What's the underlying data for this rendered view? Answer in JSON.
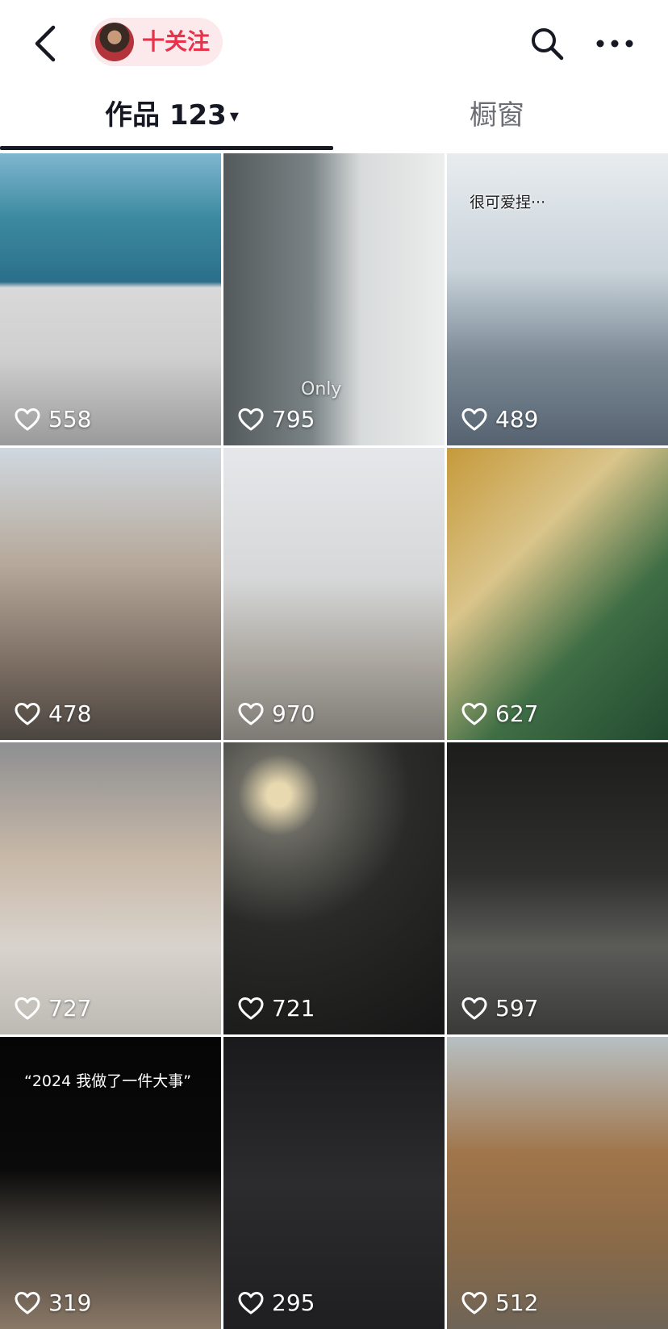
{
  "header": {
    "back_icon": "chevron-left-icon",
    "follow_label": "十关注",
    "search_icon": "search-icon",
    "more_icon": "more-horizontal-icon"
  },
  "tabs": {
    "works_label": "作品 123",
    "works_arrow": "▾",
    "window_label": "橱窗"
  },
  "colors": {
    "follow_text": "#e8324a",
    "follow_bg": "#fbe9ec",
    "text_primary": "#161823",
    "text_secondary": "#6d6e75"
  },
  "videos": [
    {
      "likes": "558"
    },
    {
      "likes": "795",
      "caption": "Only"
    },
    {
      "likes": "489",
      "caption": "很可爱捏···"
    },
    {
      "likes": "478"
    },
    {
      "likes": "970"
    },
    {
      "likes": "627"
    },
    {
      "likes": "727"
    },
    {
      "likes": "721"
    },
    {
      "likes": "597"
    },
    {
      "likes": "319",
      "caption": "“2024 我做了一件大事”"
    },
    {
      "likes": "295"
    },
    {
      "likes": "512"
    }
  ]
}
